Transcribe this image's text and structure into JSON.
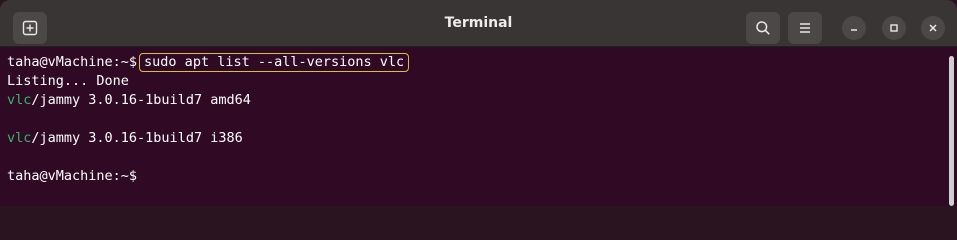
{
  "window": {
    "title": "Terminal"
  },
  "icons": {
    "new_tab": "new-tab-icon",
    "search": "search-icon",
    "menu": "hamburger-menu-icon",
    "minimize": "minimize-icon",
    "maximize": "maximize-icon",
    "close": "close-icon"
  },
  "colors": {
    "terminal_bg": "#300a24",
    "titlebar_bg": "#3a3535",
    "package_green": "#34b36a",
    "highlight_border": "#d8c03a"
  },
  "terminal": {
    "prompt": "taha@vMachine:~$",
    "command": "sudo apt list --all-versions vlc",
    "listing": "Listing... Done",
    "entries": [
      {
        "package": "vlc",
        "rest": "/jammy 3.0.16-1build7 amd64"
      },
      {
        "package": "vlc",
        "rest": "/jammy 3.0.16-1build7 i386"
      }
    ],
    "final_prompt": "taha@vMachine:~$"
  }
}
